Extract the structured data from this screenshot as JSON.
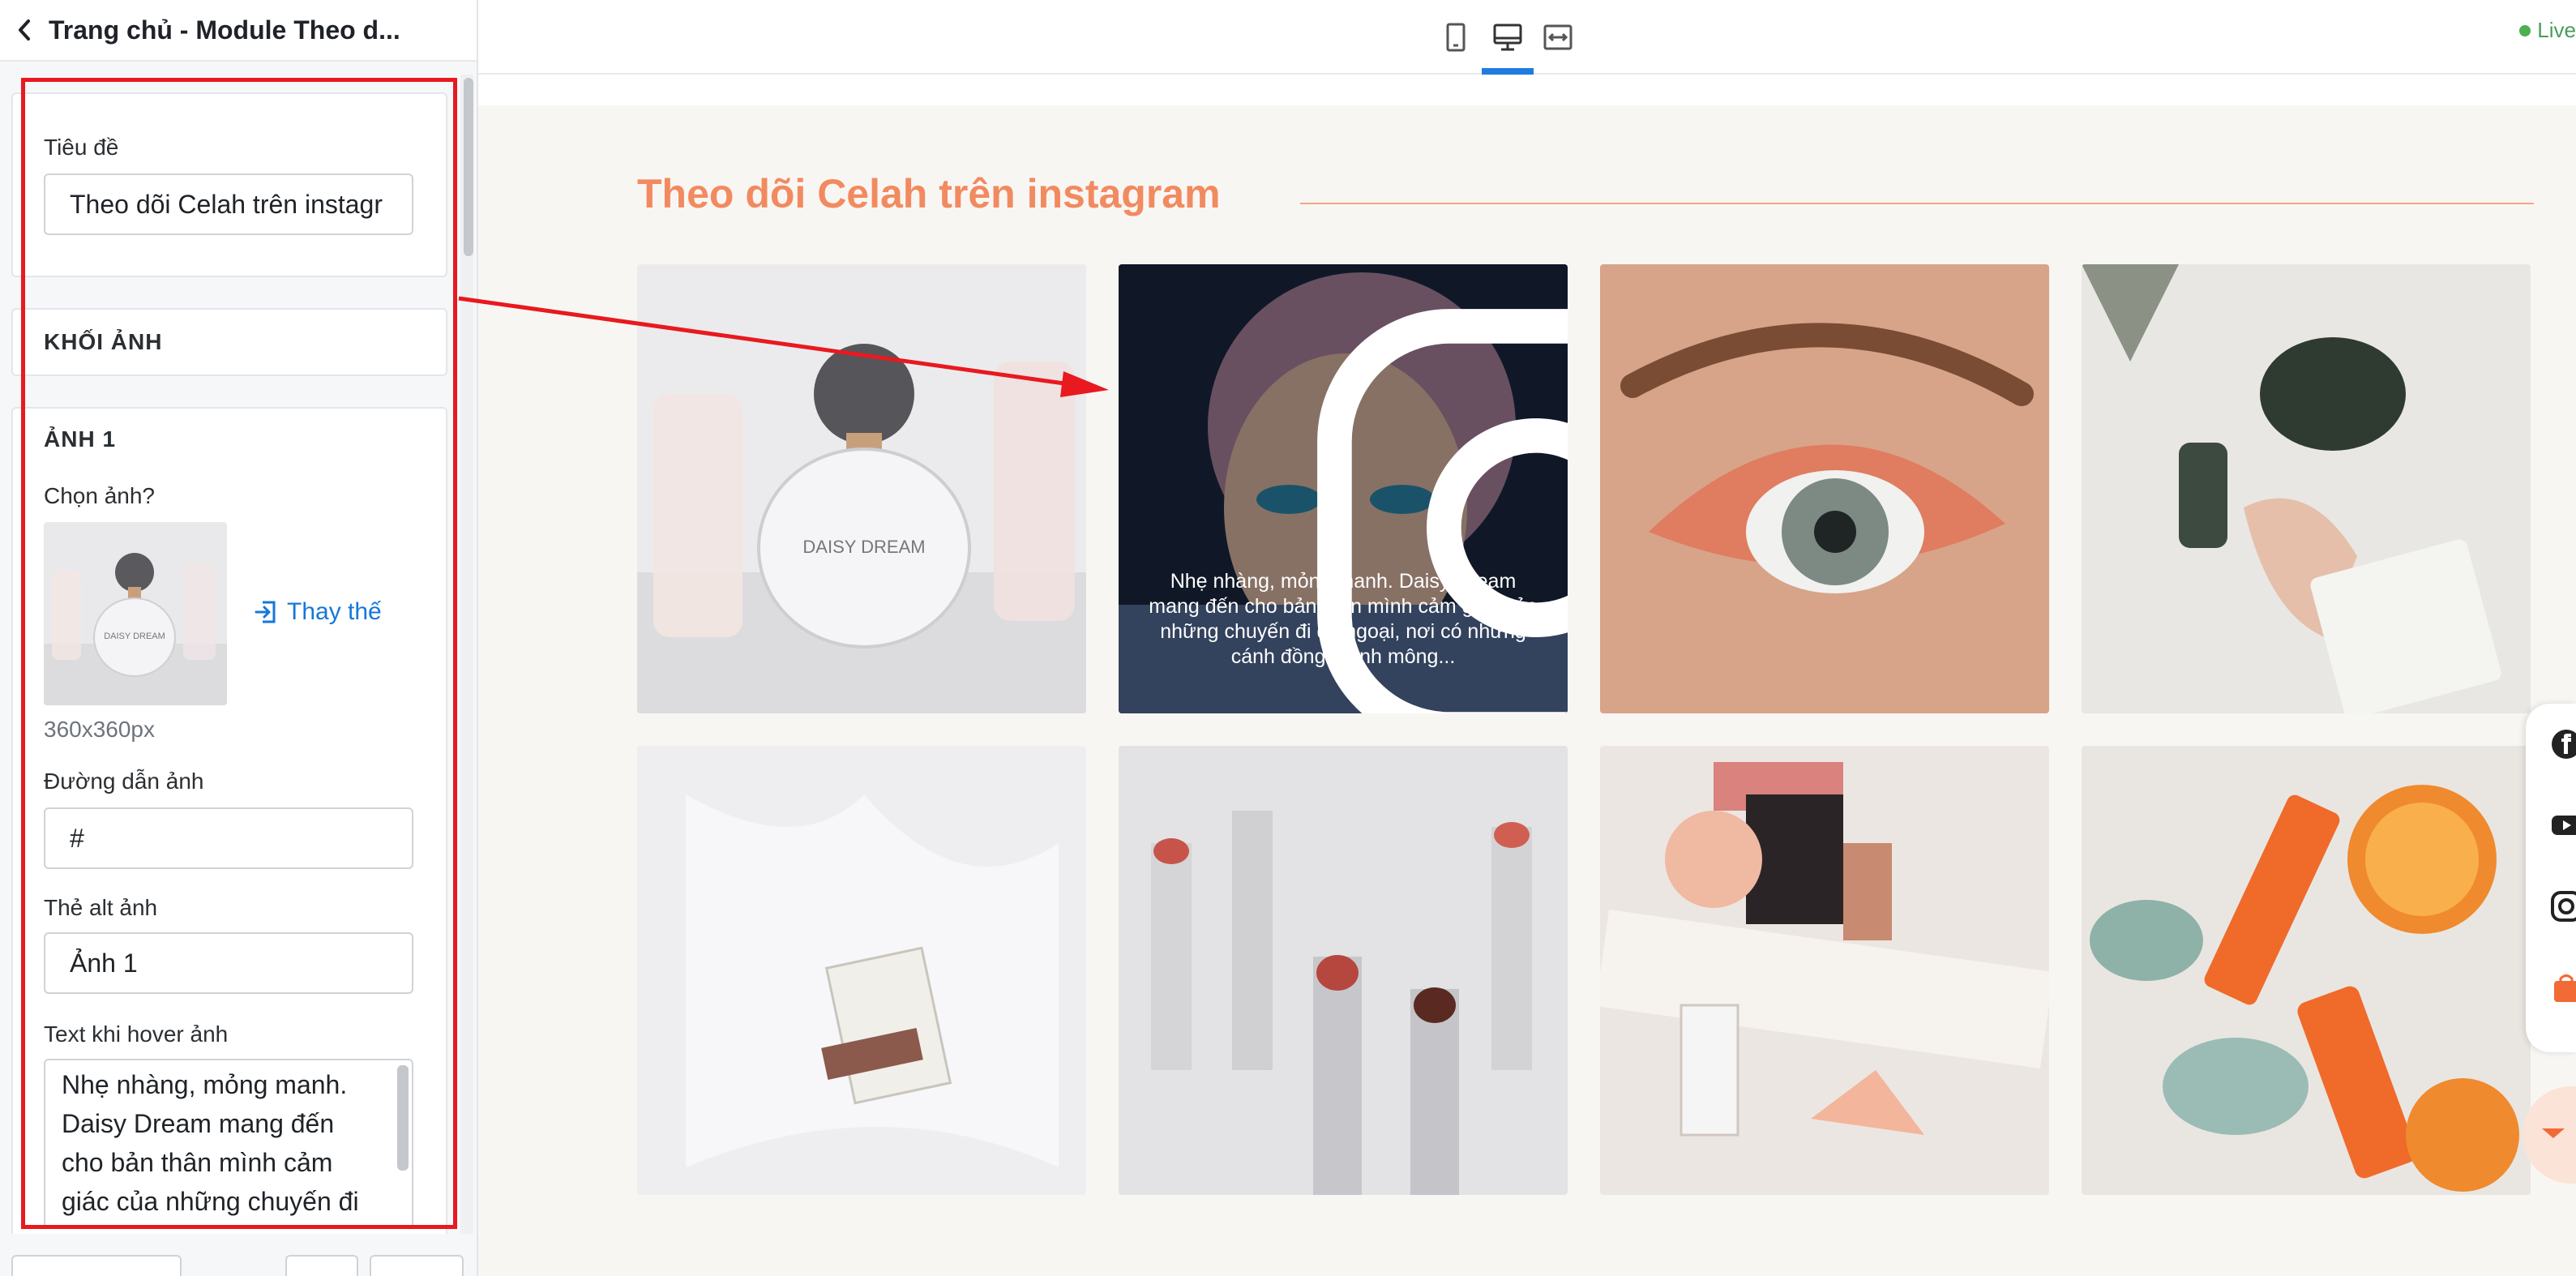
{
  "sidebar": {
    "title": "Trang chủ - Module Theo d...",
    "title_field": {
      "label": "Tiêu đề",
      "value": "Theo dõi Celah trên instagr"
    },
    "image_block": {
      "heading": "KHỐI ẢNH"
    },
    "image_1": {
      "heading": "ẢNH 1",
      "choose_label": "Chọn ảnh?",
      "replace_label": "Thay thế",
      "size_hint": "360x360px",
      "link_label": "Đường dẫn ảnh",
      "link_value": "#",
      "alt_label": "Thẻ alt ảnh",
      "alt_value": "Ảnh 1",
      "hover_label": "Text khi hover ảnh",
      "hover_value": "Nhẹ nhàng, mỏng manh. Daisy Dream mang đến cho bản thân mình cảm giác của những chuyến đi"
    }
  },
  "topbar": {
    "live_label": "Live",
    "devices": [
      "mobile-icon",
      "desktop-icon",
      "fullwidth-icon"
    ],
    "active_device": "desktop"
  },
  "preview": {
    "title": "Theo dõi Celah trên instagram",
    "hover_caption": "Nhẹ nhàng, mỏng manh. Daisy Dream mang đến cho bản thân mình cảm giác của những chuyến đi dã ngoại, nơi có những cánh đồng mênh mông..."
  },
  "colors": {
    "accent": "#f28a60",
    "link": "#1677d8",
    "highlight": "#e8191f"
  }
}
